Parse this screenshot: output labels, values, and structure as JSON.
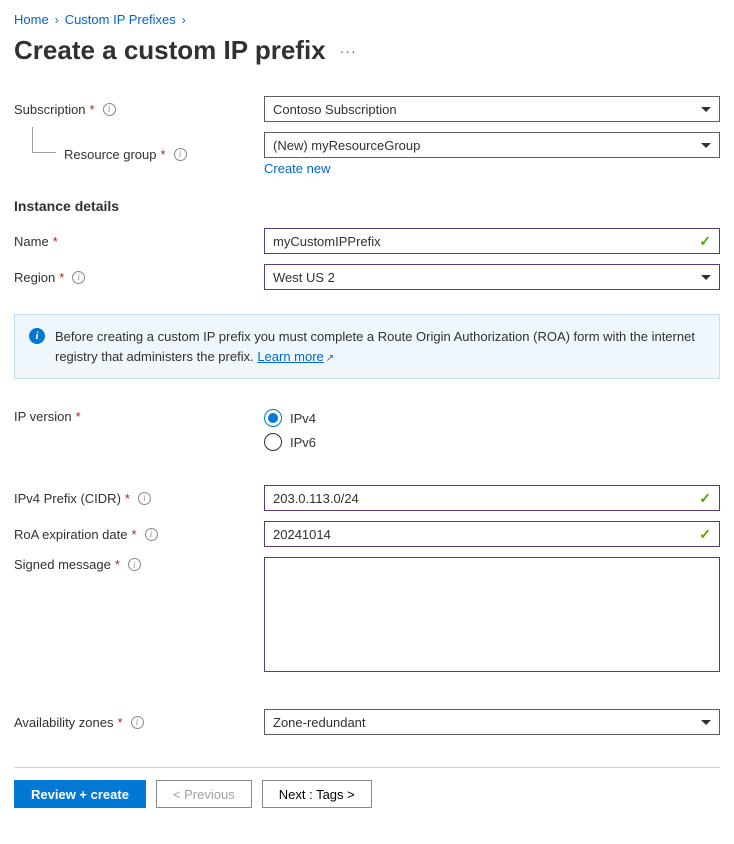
{
  "breadcrumb": {
    "home": "Home",
    "parent": "Custom IP Prefixes"
  },
  "page_title": "Create a custom IP prefix",
  "labels": {
    "subscription": "Subscription",
    "resource_group": "Resource group",
    "create_new": "Create new",
    "instance_details": "Instance details",
    "name": "Name",
    "region": "Region",
    "ip_version": "IP version",
    "ipv4_prefix": "IPv4 Prefix (CIDR)",
    "roa_expiration": "RoA expiration date",
    "signed_message": "Signed message",
    "availability_zones": "Availability zones"
  },
  "values": {
    "subscription": "Contoso Subscription",
    "resource_group": "(New) myResourceGroup",
    "name": "myCustomIPPrefix",
    "region": "West US 2",
    "ipv4": "IPv4",
    "ipv6": "IPv6",
    "ipv4_prefix": "203.0.113.0/24",
    "roa_expiration": "20241014",
    "signed_message": "",
    "availability_zones": "Zone-redundant"
  },
  "banner": {
    "text_before": "Before creating a custom IP prefix you must complete a Route Origin Authorization (ROA) form with the internet registry that administers the prefix. ",
    "link": "Learn more"
  },
  "buttons": {
    "review_create": "Review + create",
    "previous": "< Previous",
    "next": "Next : Tags >"
  }
}
